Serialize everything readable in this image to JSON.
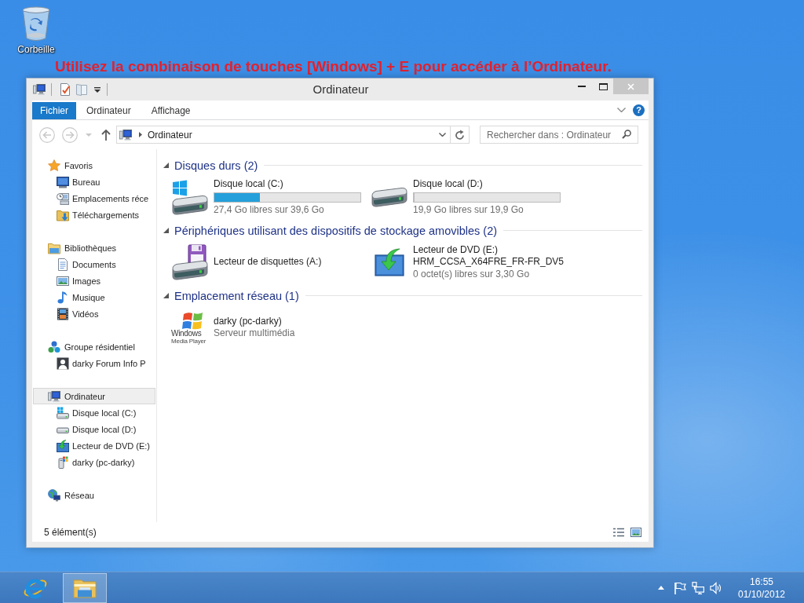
{
  "desktop": {
    "icons": [
      {
        "label": "Corbeille"
      }
    ],
    "caption": "Utilisez la combinaison de touches [Windows] + E pour accéder à l’Ordinateur."
  },
  "window": {
    "title": "Ordinateur",
    "ribbon": {
      "tabs": [
        {
          "label": "Fichier",
          "kind": "file"
        },
        {
          "label": "Ordinateur",
          "kind": "tab"
        },
        {
          "label": "Affichage",
          "kind": "tab"
        }
      ],
      "help": "?"
    },
    "nav_buttons": [
      {
        "kind": "back",
        "disabled": true
      },
      {
        "kind": "forward",
        "disabled": true
      },
      {
        "kind": "recent",
        "disabled": true
      },
      {
        "kind": "up",
        "disabled": false
      }
    ],
    "address": {
      "path": "Ordinateur"
    },
    "search": {
      "placeholder": "Rechercher dans : Ordinateur"
    },
    "sidebar": {
      "items": [
        {
          "label": "Favoris",
          "kind": "favorites",
          "selected": false,
          "children": [
            {
              "label": "Bureau",
              "kind": "desktop",
              "selected": false
            },
            {
              "label": "Emplacements réce",
              "kind": "recent-places",
              "selected": false
            },
            {
              "label": "Téléchargements",
              "kind": "downloads",
              "selected": false
            }
          ]
        },
        {
          "label": "Bibliothèques",
          "kind": "libraries",
          "selected": false,
          "children": [
            {
              "label": "Documents",
              "kind": "documents",
              "selected": false
            },
            {
              "label": "Images",
              "kind": "pictures",
              "selected": false
            },
            {
              "label": "Musique",
              "kind": "music",
              "selected": false
            },
            {
              "label": "Vidéos",
              "kind": "videos",
              "selected": false
            }
          ]
        },
        {
          "label": "Groupe résidentiel",
          "kind": "homegroup",
          "selected": false,
          "children": [
            {
              "label": "darky Forum Info P",
              "kind": "user",
              "selected": false
            }
          ]
        },
        {
          "label": "Ordinateur",
          "kind": "computer",
          "selected": true,
          "children": [
            {
              "label": "Disque local (C:)",
              "kind": "system-drive",
              "selected": false
            },
            {
              "label": "Disque local (D:)",
              "kind": "drive",
              "selected": false
            },
            {
              "label": "Lecteur de DVD (E:)",
              "kind": "dvd",
              "selected": false
            },
            {
              "label": "darky (pc-darky)",
              "kind": "media-server",
              "selected": false
            }
          ]
        },
        {
          "label": "Réseau",
          "kind": "network",
          "selected": false
        }
      ]
    },
    "groups": [
      {
        "title": "Disques durs (2)",
        "expanded": true,
        "items": [
          {
            "kind": "system-drive",
            "name": "Disque local (C:)",
            "level": 0.31,
            "detail": "27,4 Go libres sur 39,6 Go"
          },
          {
            "kind": "drive",
            "name": "Disque local (D:)",
            "level": 0,
            "detail": "19,9 Go libres sur 19,9 Go"
          }
        ]
      },
      {
        "title": "Périphériques utilisant des dispositifs de stockage amovibles (2)",
        "expanded": true,
        "items": [
          {
            "kind": "floppy",
            "name": "Lecteur de disquettes (A:)"
          },
          {
            "kind": "dvd",
            "name": "Lecteur de DVD (E:)",
            "label": "HRM_CCSA_X64FRE_FR-FR_DV5",
            "detail": "0 octet(s) libres sur 3,30 Go"
          }
        ]
      },
      {
        "title": "Emplacement réseau (1)",
        "expanded": true,
        "items": [
          {
            "kind": "media-server",
            "name": "darky (pc-darky)",
            "detail": "Serveur multimédia",
            "logo_text": [
              "Windows",
              "Media Player"
            ]
          }
        ]
      }
    ],
    "status_bar": {
      "text": "5 élément(s)"
    }
  },
  "taskbar": {
    "apps": [
      {
        "kind": "browser",
        "active": false
      },
      {
        "kind": "explorer",
        "active": true
      }
    ],
    "clock": {
      "time": "16:55",
      "date": "01/10/2012"
    }
  }
}
